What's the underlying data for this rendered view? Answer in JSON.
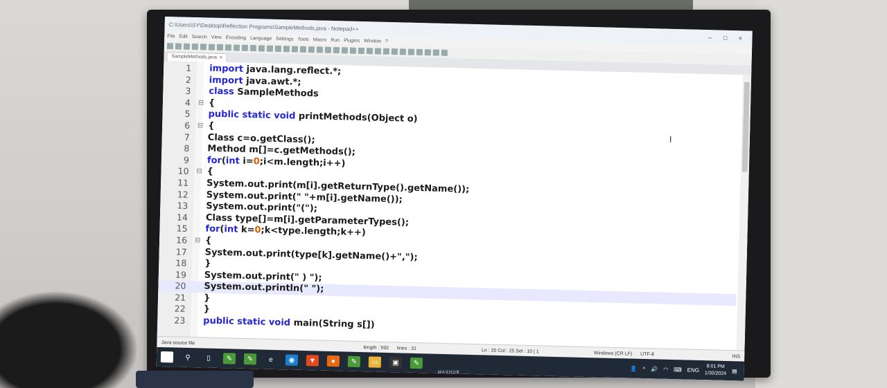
{
  "window": {
    "title": "C:\\Users\\SY\\Desktop\\Reflection Programs\\SampleMethods.java - Notepad++",
    "controls": [
      "–",
      "□",
      "×"
    ]
  },
  "menu": [
    "File",
    "Edit",
    "Search",
    "View",
    "Encoding",
    "Language",
    "Settings",
    "Tools",
    "Macro",
    "Run",
    "Plugins",
    "Window",
    "?"
  ],
  "tab": {
    "label": "SampleMethods.java",
    "close": "×"
  },
  "code_lines": [
    {
      "n": "1",
      "fold": "",
      "text": "import java.lang.reflect.*;"
    },
    {
      "n": "2",
      "fold": "",
      "text": "import java.awt.*;"
    },
    {
      "n": "3",
      "fold": "",
      "text": "class SampleMethods"
    },
    {
      "n": "4",
      "fold": "⊟",
      "text": "{"
    },
    {
      "n": "5",
      "fold": "",
      "text": "public static void printMethods(Object o)"
    },
    {
      "n": "6",
      "fold": "⊟",
      "text": "{"
    },
    {
      "n": "7",
      "fold": "",
      "text": "Class c=o.getClass();"
    },
    {
      "n": "8",
      "fold": "",
      "text": "Method m[]=c.getMethods();"
    },
    {
      "n": "9",
      "fold": "",
      "text": "for(int i=0;i<m.length;i++)"
    },
    {
      "n": "10",
      "fold": "⊟",
      "text": "{"
    },
    {
      "n": "11",
      "fold": "",
      "text": "System.out.print(m[i].getReturnType().getName());"
    },
    {
      "n": "12",
      "fold": "",
      "text": "System.out.print(\" \"+m[i].getName());"
    },
    {
      "n": "13",
      "fold": "",
      "text": "System.out.print(\"(\");"
    },
    {
      "n": "14",
      "fold": "",
      "text": "Class type[]=m[i].getParameterTypes();"
    },
    {
      "n": "15",
      "fold": "",
      "text": "for(int k=0;k<type.length;k++)"
    },
    {
      "n": "16",
      "fold": "⊟",
      "text": "{"
    },
    {
      "n": "17",
      "fold": "",
      "text": "System.out.print(type[k].getName()+\",\");"
    },
    {
      "n": "18",
      "fold": "",
      "text": "}"
    },
    {
      "n": "19",
      "fold": "",
      "text": "System.out.print(\" ) \");"
    },
    {
      "n": "20",
      "fold": "",
      "text": "System.out.println(\" \");"
    },
    {
      "n": "21",
      "fold": "",
      "text": "}"
    },
    {
      "n": "22",
      "fold": "",
      "text": "}"
    },
    {
      "n": "23",
      "fold": "",
      "text": "public static void main(String s[])"
    }
  ],
  "status": {
    "file_type": "Java source file",
    "length": "length : 592",
    "lines": "lines : 31",
    "position": "Ln : 20   Col : 25   Sel : 10 | 1",
    "eol": "Windows (CR LF)",
    "encoding": "UTF-8",
    "mode": "INS"
  },
  "taskbar": {
    "icons": [
      "start-icon",
      "search-icon",
      "task-view-icon",
      "notepad-plus-icon",
      "notepad-plus-icon",
      "edge-legacy-icon",
      "edge-icon",
      "brave-icon",
      "firefox-icon",
      "notepad-plus-icon",
      "file-explorer-icon",
      "terminal-icon",
      "notepad-plus-active-icon"
    ],
    "language": "ENG",
    "time": "8:01 PM",
    "date": "1/30/2024"
  },
  "brand": "MAXHUB",
  "colors": {
    "keyword": "#2424d8",
    "number": "#e15b00",
    "text": "#1a1a1a",
    "taskbar": "#202a36"
  }
}
